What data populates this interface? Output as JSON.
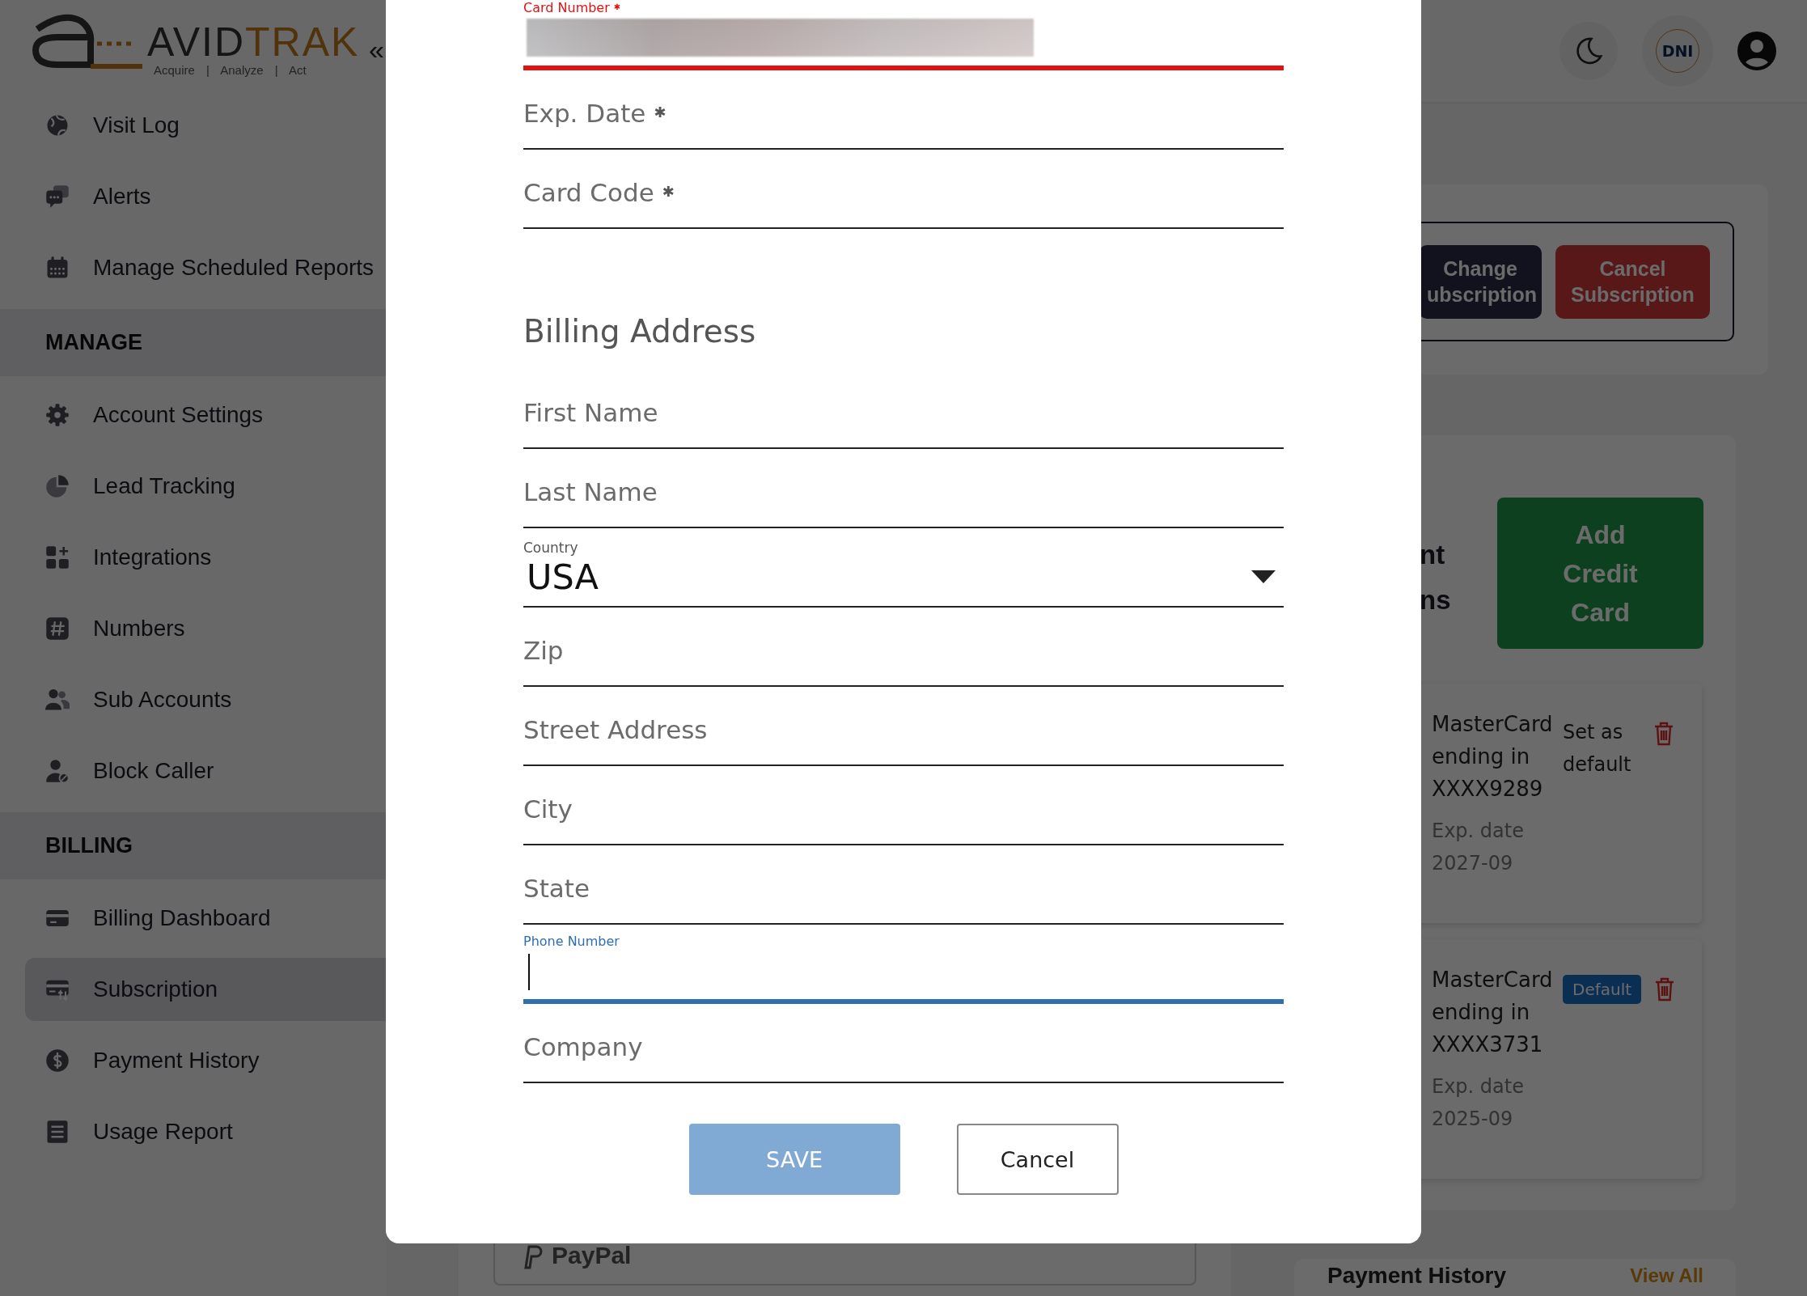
{
  "logo": {
    "word_dark": "AVID",
    "word_accent": "TRAK",
    "tagline": "Acquire | Analyze | Act",
    "collapse": "«"
  },
  "sidebar": {
    "sections": [
      {
        "items": [
          {
            "label": "Visit Log",
            "selected": false
          },
          {
            "label": "Alerts",
            "selected": false
          },
          {
            "label": "Manage Scheduled Reports",
            "selected": false
          }
        ]
      },
      {
        "heading": "MANAGE",
        "items": [
          {
            "label": "Account Settings",
            "selected": false
          },
          {
            "label": "Lead Tracking",
            "selected": false
          },
          {
            "label": "Integrations",
            "selected": false
          },
          {
            "label": "Numbers",
            "selected": false
          },
          {
            "label": "Sub Accounts",
            "selected": false
          },
          {
            "label": "Block Caller",
            "selected": false
          }
        ]
      },
      {
        "heading": "BILLING",
        "items": [
          {
            "label": "Billing Dashboard",
            "selected": false
          },
          {
            "label": "Subscription",
            "selected": true
          },
          {
            "label": "Payment History",
            "selected": false
          },
          {
            "label": "Usage Report",
            "selected": false
          }
        ]
      }
    ]
  },
  "header": {
    "avatar_initials": "DNI"
  },
  "subscription_actions": [
    {
      "label": "Change ubscription",
      "kind": "dark"
    },
    {
      "label": "Cancel Subscription",
      "kind": "danger"
    }
  ],
  "payment_methods": {
    "title_fragments": [
      "nt",
      "ns"
    ],
    "add_button": "Add Credit Card",
    "cards": [
      {
        "description": "MasterCard ending in XXXX9289",
        "expiry": "Exp. date 2027-09",
        "default": false,
        "action": "Set as default"
      },
      {
        "description": "MasterCard ending in XXXX3731",
        "expiry": "Exp. date 2025-09",
        "default": true,
        "badge": "Default"
      }
    ]
  },
  "paypal": "PayPal",
  "payment_history": {
    "title": "Payment History",
    "link": "View All"
  },
  "modal": {
    "required_mark": "✱",
    "fields": [
      {
        "kind": "text",
        "label": "Card Number",
        "required": true,
        "error": true,
        "focused": false,
        "redacted": true
      },
      {
        "kind": "text",
        "label": "Exp. Date",
        "required": true,
        "error": false,
        "focused": false,
        "redacted": false
      },
      {
        "kind": "text",
        "label": "Card Code",
        "required": true,
        "error": false,
        "focused": false,
        "redacted": false
      },
      {
        "kind": "heading",
        "label": "Billing Address"
      },
      {
        "kind": "text",
        "label": "First Name",
        "required": false,
        "error": false,
        "focused": false,
        "redacted": false
      },
      {
        "kind": "text",
        "label": "Last Name",
        "required": false,
        "error": false,
        "focused": false,
        "redacted": false
      },
      {
        "kind": "select",
        "label": "Country",
        "value": "USA"
      },
      {
        "kind": "text",
        "label": "Zip",
        "required": false,
        "error": false,
        "focused": false,
        "redacted": false
      },
      {
        "kind": "text",
        "label": "Street Address",
        "required": false,
        "error": false,
        "focused": false,
        "redacted": false
      },
      {
        "kind": "text",
        "label": "City",
        "required": false,
        "error": false,
        "focused": false,
        "redacted": false
      },
      {
        "kind": "text",
        "label": "State",
        "required": false,
        "error": false,
        "focused": false,
        "redacted": false
      },
      {
        "kind": "text",
        "label": "Phone Number",
        "required": false,
        "error": false,
        "focused": true,
        "redacted": false
      },
      {
        "kind": "text",
        "label": "Company",
        "required": false,
        "error": false,
        "focused": false,
        "redacted": false
      }
    ],
    "buttons": [
      {
        "label": "SAVE",
        "kind": "primary",
        "disabled": true
      },
      {
        "label": "Cancel",
        "kind": "secondary",
        "disabled": false
      }
    ]
  }
}
